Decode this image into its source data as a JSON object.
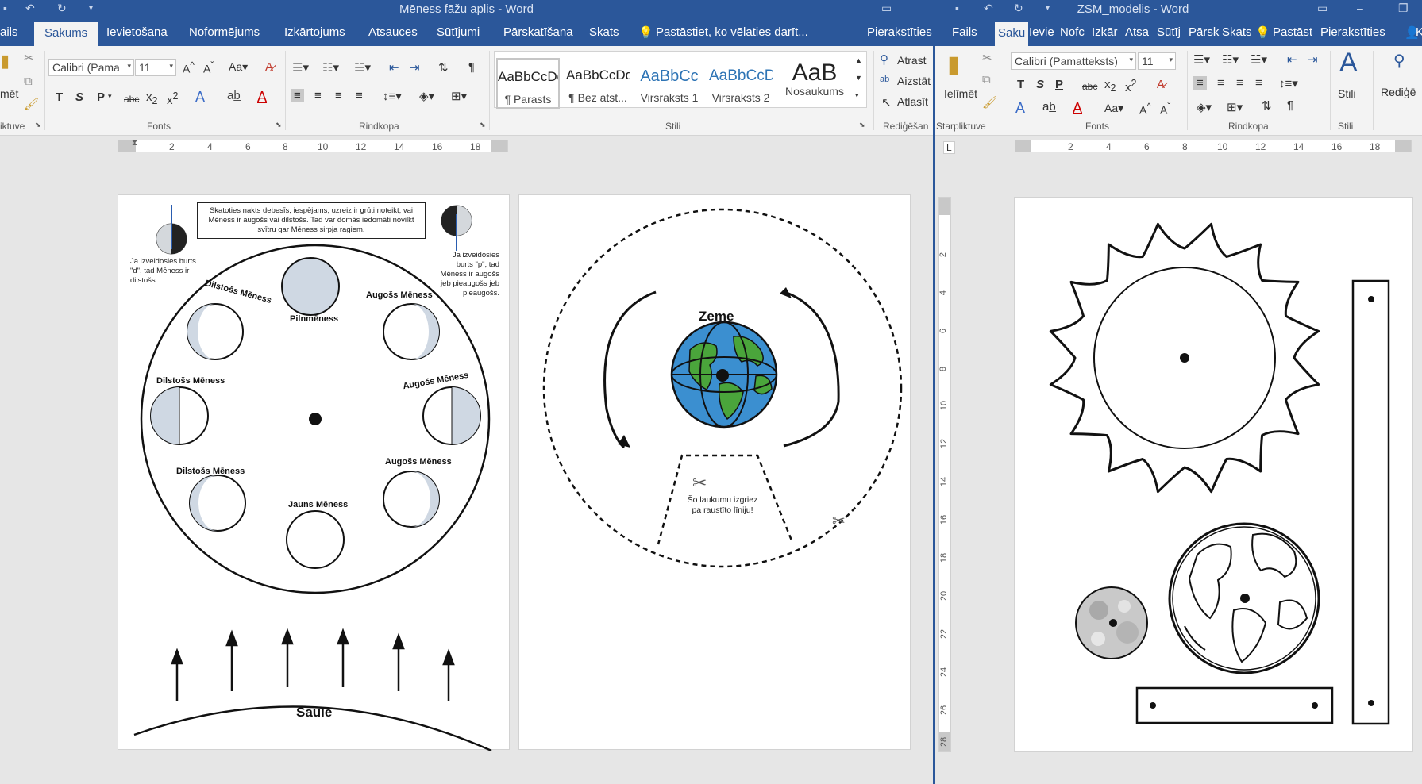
{
  "left_window": {
    "title": "Mēness fāžu aplis - Word",
    "tabs": [
      "ails",
      "Sākums",
      "Ievietošana",
      "Noformējums",
      "Izkārtojums",
      "Atsauces",
      "Sūtījumi",
      "Pārskatīšana",
      "Skats"
    ],
    "active_tab": "Sākums",
    "tell_me": "Pastāstiet, ko vēlaties darīt...",
    "sign_in": "Pierakstīties",
    "ribbon": {
      "paste_label": "mēt",
      "clipboard_group": "iktuve",
      "font_name": "Calibri (Pama",
      "font_size": "11",
      "font_group": "Fonts",
      "paragraph_group": "Rindkopa",
      "styles_group": "Stili",
      "editing_group": "Rediģēšan",
      "bold": "T",
      "italic": "S",
      "underline": "P",
      "strike": "abc",
      "aa": "Aa",
      "styles": [
        {
          "preview": "AaBbCcDd",
          "name": "¶ Parasts"
        },
        {
          "preview": "AaBbCcDd",
          "name": "¶ Bez atst..."
        },
        {
          "preview": "AaBbCc",
          "name": "Virsraksts 1"
        },
        {
          "preview": "AaBbCcD",
          "name": "Virsraksts 2"
        },
        {
          "preview": "AaB",
          "name": "Nosaukums"
        }
      ],
      "find": "Atrast",
      "replace": "Aizstāt",
      "select": "Atlasīt"
    },
    "ruler_numbers": [
      "2",
      "4",
      "6",
      "8",
      "10",
      "12",
      "14",
      "16",
      "18"
    ],
    "page1": {
      "intro_text": "Skatoties nakts debesīs, iespējams, uzreiz ir grūti noteikt, vai Mēness ir augošs vai dilstošs. Tad var domās iedomāti novilkt svītru gar Mēness sirpja ragiem.",
      "left_note": "Ja izveidosies burts \"d\", tad Mēness ir dilstošs.",
      "right_note": "Ja izveidosies burts \"p\", tad Mēness ir augošs jeb pieaugošs jeb pieaugošs.",
      "phases": {
        "full": "Pilnmēness",
        "new": "Jauns Mēness",
        "waning": "Dilstošs Mēness",
        "waxing": "Augošs Mēness"
      },
      "sun_label": "Saule"
    },
    "page2": {
      "earth_label": "Zeme",
      "cut_note": "Šo laukumu izgriez pa raustīto līniju!"
    }
  },
  "right_window": {
    "title": "ZSM_modelis - Word",
    "tabs": [
      "Fails",
      "Sāku",
      "Ievie",
      "Nofc",
      "Izkār",
      "Atsa",
      "Sūtīj",
      "Pārsk",
      "Skats"
    ],
    "active_tab": "Sāku",
    "tell_me": "Pastāst",
    "sign_in": "Pierakstīties",
    "user": "K",
    "ribbon": {
      "paste_label": "Ielīmēt",
      "clipboard_group": "Starpliktuve",
      "font_name": "Calibri (Pamatteksts)",
      "font_size": "11",
      "font_group": "Fonts",
      "paragraph_group": "Rindkopa",
      "styles_label": "Stili",
      "styles_group": "Stili",
      "editing_label": "Rediģē",
      "bold": "T",
      "italic": "S",
      "underline": "P",
      "strike": "abc",
      "aa": "Aa"
    },
    "ruler_numbers": [
      "2",
      "4",
      "6",
      "8",
      "10",
      "12",
      "14",
      "16",
      "18"
    ],
    "vruler_numbers": [
      "2",
      "4",
      "6",
      "8",
      "10",
      "12",
      "14",
      "16",
      "18",
      "20",
      "22",
      "24",
      "26",
      "28"
    ]
  },
  "colors": {
    "accent": "#2b579a",
    "ribbon_bg": "#f3f3f3",
    "workspace": "#e6e6e6",
    "moon_fill": "#cfd8e3"
  }
}
